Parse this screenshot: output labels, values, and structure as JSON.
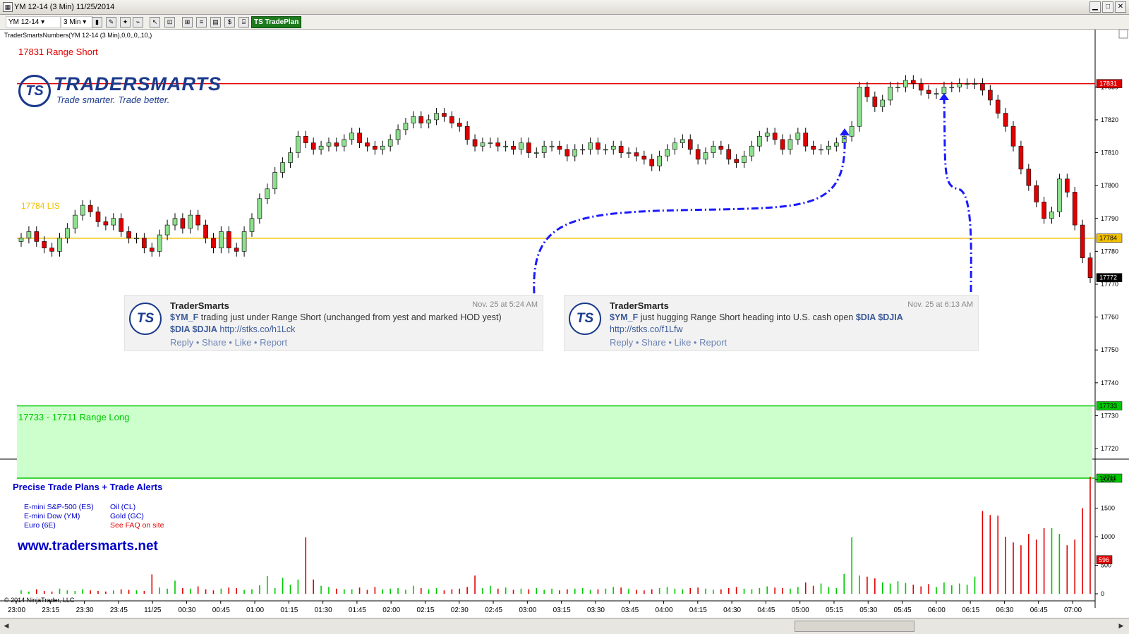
{
  "window": {
    "title": "YM 12-14 (3 Min)  11/25/2014"
  },
  "toolbar": {
    "instrument": "YM 12-14",
    "interval": "3 Min",
    "tradeplan_label": "TS TradePlan"
  },
  "indicator_label": "TraderSmartsNumbers(YM 12-14 (3 Min),0,0,,0,,10,)",
  "brand": {
    "name": "TRADERSMARTS",
    "slogan": "Trade smarter. Trade better.",
    "logo_text": "TS"
  },
  "levels": {
    "range_short_label": "17831 Range Short",
    "range_long_label": "17733 - 17711 Range Long",
    "mid_label": "17784 LIS",
    "range_short_value": "17831",
    "mid_value": "17784",
    "range_long_top": "17733",
    "range_long_bottom": "17711",
    "last_price": "17772",
    "volume_last": "596"
  },
  "y_axis": [
    "17830",
    "17820",
    "17810",
    "17800",
    "17790",
    "17780",
    "17770",
    "17760",
    "17750",
    "17740",
    "17730",
    "17720"
  ],
  "vol_axis": [
    "2000",
    "1500",
    "1000",
    "500",
    "0"
  ],
  "x_axis": [
    "23:00",
    "23:15",
    "23:30",
    "23:45",
    "11/25",
    "00:30",
    "00:45",
    "01:00",
    "01:15",
    "01:30",
    "01:45",
    "02:00",
    "02:15",
    "02:30",
    "02:45",
    "03:00",
    "03:15",
    "03:30",
    "03:45",
    "04:00",
    "04:15",
    "04:30",
    "04:45",
    "05:00",
    "05:15",
    "05:30",
    "05:45",
    "06:00",
    "06:15",
    "06:30",
    "06:45",
    "07:00"
  ],
  "tweets": [
    {
      "name": "TraderSmarts",
      "time": "Nov. 25 at 5:24 AM",
      "line1_tag": "$YM_F",
      "line1_text": " trading just under Range Short (unchanged from yest and marked HOD yest)",
      "line2_tags": "$DIA $DJIA",
      "line2_link": "http://stks.co/h1Lck",
      "actions": "Reply • Share • Like • Report"
    },
    {
      "name": "TraderSmarts",
      "time": "Nov. 25 at 6:13 AM",
      "line1_tag": "$YM_F",
      "line1_text": " just hugging Range Short heading into U.S. cash open ",
      "line1_tags2": "$DIA $DJIA",
      "line2_link": "http://stks.co/f1Lfw",
      "actions": "Reply • Share • Like • Report"
    }
  ],
  "promo": {
    "title": "Precise Trade Plans + Trade Alerts",
    "col1": [
      "E-mini S&P-500 (ES)",
      "E-mini Dow (YM)",
      "Euro (6E)"
    ],
    "col2": [
      "Oil (CL)",
      "Gold (GC)",
      "See FAQ on site"
    ],
    "website": "www.tradersmarts.net"
  },
  "copyright": "© 2014 NinjaTrader, LLC",
  "colors": {
    "up": "#8ee08e",
    "down": "#e00000",
    "short": "#e00000",
    "long": "#00c800",
    "mid": "#f0c000",
    "zone": "#ccffcc"
  },
  "chart_data": {
    "type": "candlestick",
    "price_range": [
      17708,
      17838
    ],
    "closes": [
      17784,
      17786,
      17783,
      17781,
      17780,
      17784,
      17787,
      17791,
      17794,
      17792,
      17789,
      17788,
      17790,
      17786,
      17784,
      17784,
      17781,
      17780,
      17785,
      17788,
      17790,
      17787,
      17791,
      17788,
      17784,
      17781,
      17786,
      17781,
      17780,
      17786,
      17790,
      17796,
      17799,
      17804,
      17807,
      17810,
      17815,
      17813,
      17811,
      17812,
      17813,
      17812,
      17814,
      17816,
      17813,
      17812,
      17811,
      17812,
      17814,
      17817,
      17819,
      17821,
      17819,
      17820,
      17822,
      17821,
      17819,
      17818,
      17814,
      17812,
      17813,
      17813,
      17812,
      17812,
      17811,
      17813,
      17810,
      17810,
      17812,
      17812,
      17811,
      17809,
      17811,
      17811,
      17813,
      17811,
      17811,
      17812,
      17810,
      17810,
      17809,
      17808,
      17806,
      17809,
      17811,
      17813,
      17814,
      17811,
      17808,
      17810,
      17812,
      17811,
      17808,
      17807,
      17809,
      17812,
      17815,
      17816,
      17814,
      17811,
      17814,
      17816,
      17812,
      17811,
      17811,
      17812,
      17813,
      17815,
      17818,
      17830,
      17827,
      17824,
      17826,
      17830,
      17830,
      17832,
      17831,
      17829,
      17828,
      17828,
      17830,
      17830,
      17831,
      17831,
      17831,
      17829,
      17826,
      17822,
      17818,
      17812,
      17805,
      17800,
      17795,
      17790,
      17792,
      17802,
      17798,
      17788,
      17778,
      17772
    ],
    "volumes": [
      60,
      40,
      80,
      50,
      40,
      90,
      60,
      50,
      80,
      60,
      50,
      40,
      60,
      80,
      70,
      60,
      50,
      340,
      110,
      90,
      230,
      100,
      90,
      130,
      80,
      60,
      90,
      110,
      100,
      70,
      80,
      150,
      310,
      100,
      280,
      160,
      250,
      990,
      250,
      140,
      120,
      90,
      80,
      80,
      110,
      70,
      120,
      80,
      90,
      100,
      70,
      140,
      100,
      80,
      100,
      60,
      80,
      90,
      120,
      320,
      100,
      140,
      90,
      110,
      70,
      90,
      80,
      100,
      70,
      90,
      60,
      80,
      90,
      100,
      70,
      80,
      90,
      120,
      110,
      90,
      70,
      60,
      80,
      100,
      120,
      90,
      80,
      100,
      110,
      90,
      70,
      80,
      100,
      120,
      90,
      80,
      100,
      130,
      110,
      100,
      90,
      120,
      200,
      140,
      180,
      120,
      100,
      350,
      990,
      320,
      300,
      270,
      200,
      180,
      220,
      190,
      160,
      130,
      170,
      120,
      200,
      150,
      180,
      160,
      300,
      1450,
      1380,
      1370,
      1000,
      900,
      850,
      1050,
      950,
      1150,
      1150,
      1050,
      850,
      950,
      1500,
      2050,
      596
    ]
  }
}
